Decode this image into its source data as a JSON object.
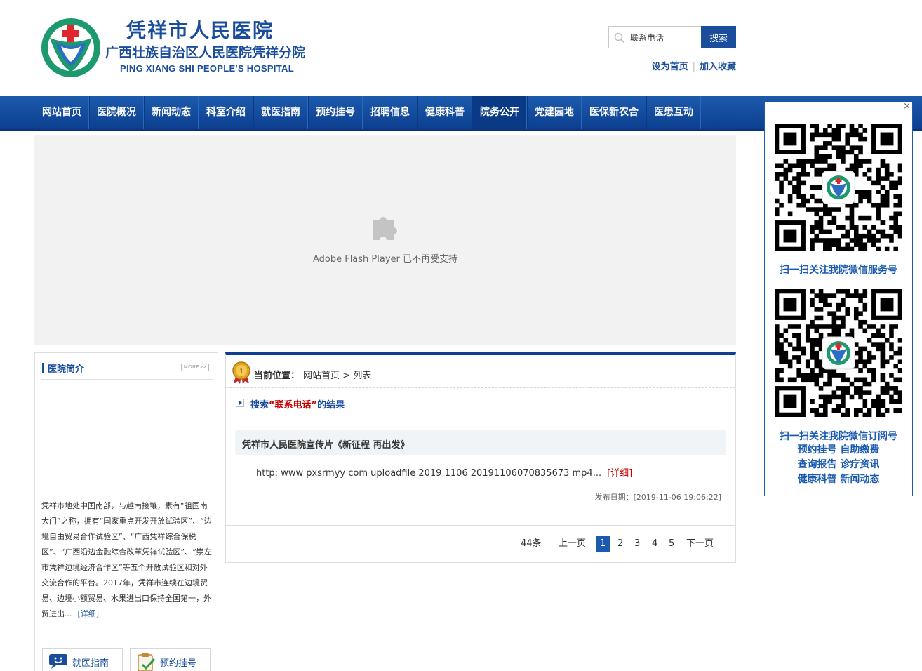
{
  "header": {
    "title_cn": "凭祥市人民医院",
    "title_sub": "广西壮族自治区人民医院凭祥分院",
    "title_en": "PING XIANG SHI PEOPLE'S HOSPITAL",
    "search_value": "联系电话",
    "search_button": "搜索",
    "link_home": "设为首页",
    "link_sep": "|",
    "link_fav": "加入收藏"
  },
  "nav": {
    "items": [
      {
        "label": "网站首页"
      },
      {
        "label": "医院概况"
      },
      {
        "label": "新闻动态"
      },
      {
        "label": "科室介绍"
      },
      {
        "label": "就医指南"
      },
      {
        "label": "预约挂号"
      },
      {
        "label": "招聘信息"
      },
      {
        "label": "健康科普"
      },
      {
        "label": "院务公开"
      },
      {
        "label": "党建园地"
      },
      {
        "label": "医保新农合"
      },
      {
        "label": "医患互动"
      }
    ],
    "active_index": 8
  },
  "flash": {
    "message": "Adobe Flash Player 已不再受支持"
  },
  "left": {
    "title": "医院简介",
    "more": "MORE>>",
    "intro": "凭祥市地处中国南部，与越南接壤，素有“祖国南大门”之称，拥有“国家重点开发开放试验区”、“边境自由贸易合作试验区”、“广西凭祥综合保税区”、“广西沿边金融综合改革凭祥试验区”、“崇左市凭祥边境经济合作区”等五个开放试验区和对外交流合作的平台。2017年，凭祥市连续在边境贸易、边境小额贸易、水果进出口保持全国第一，外贸进出...",
    "intro_detail": "[详细]",
    "btn_guide": "就医指南",
    "btn_appoint": "预约挂号"
  },
  "main": {
    "crumb_label": "当前位置：",
    "crumb_home": "网站首页",
    "crumb_sep": ">",
    "crumb_current": "列表",
    "result_pre": "搜索",
    "result_kw": "“联系电话”",
    "result_post": "的结果",
    "item_title": "凭祥市人民医院宣传片《新征程 再出发》",
    "item_desc": "http: www pxsrmyy com uploadfile 2019 1106 20191106070835673 mp4...",
    "item_detail": "[详细]",
    "item_date": "发布日期：[2019-11-06 19:06:22]"
  },
  "pager": {
    "total": "44条",
    "prev": "上一页",
    "pages": [
      "1",
      "2",
      "3",
      "4",
      "5"
    ],
    "current": "1",
    "next": "下一页"
  },
  "qr": {
    "close": "×",
    "caption1": "扫一扫关注我院微信服务号",
    "caption2": "扫一扫关注我院微信订阅号",
    "links_row1": "预约挂号  自助缴费",
    "links_row2": "查询报告  诊疗资讯",
    "links_row3": "健康科普  新闻动态"
  },
  "colors": {
    "brand_blue": "#1a4e9c",
    "nav_dark": "#0c3f8f",
    "accent_red": "#c40000",
    "logo_green": "#1c9a6d"
  }
}
